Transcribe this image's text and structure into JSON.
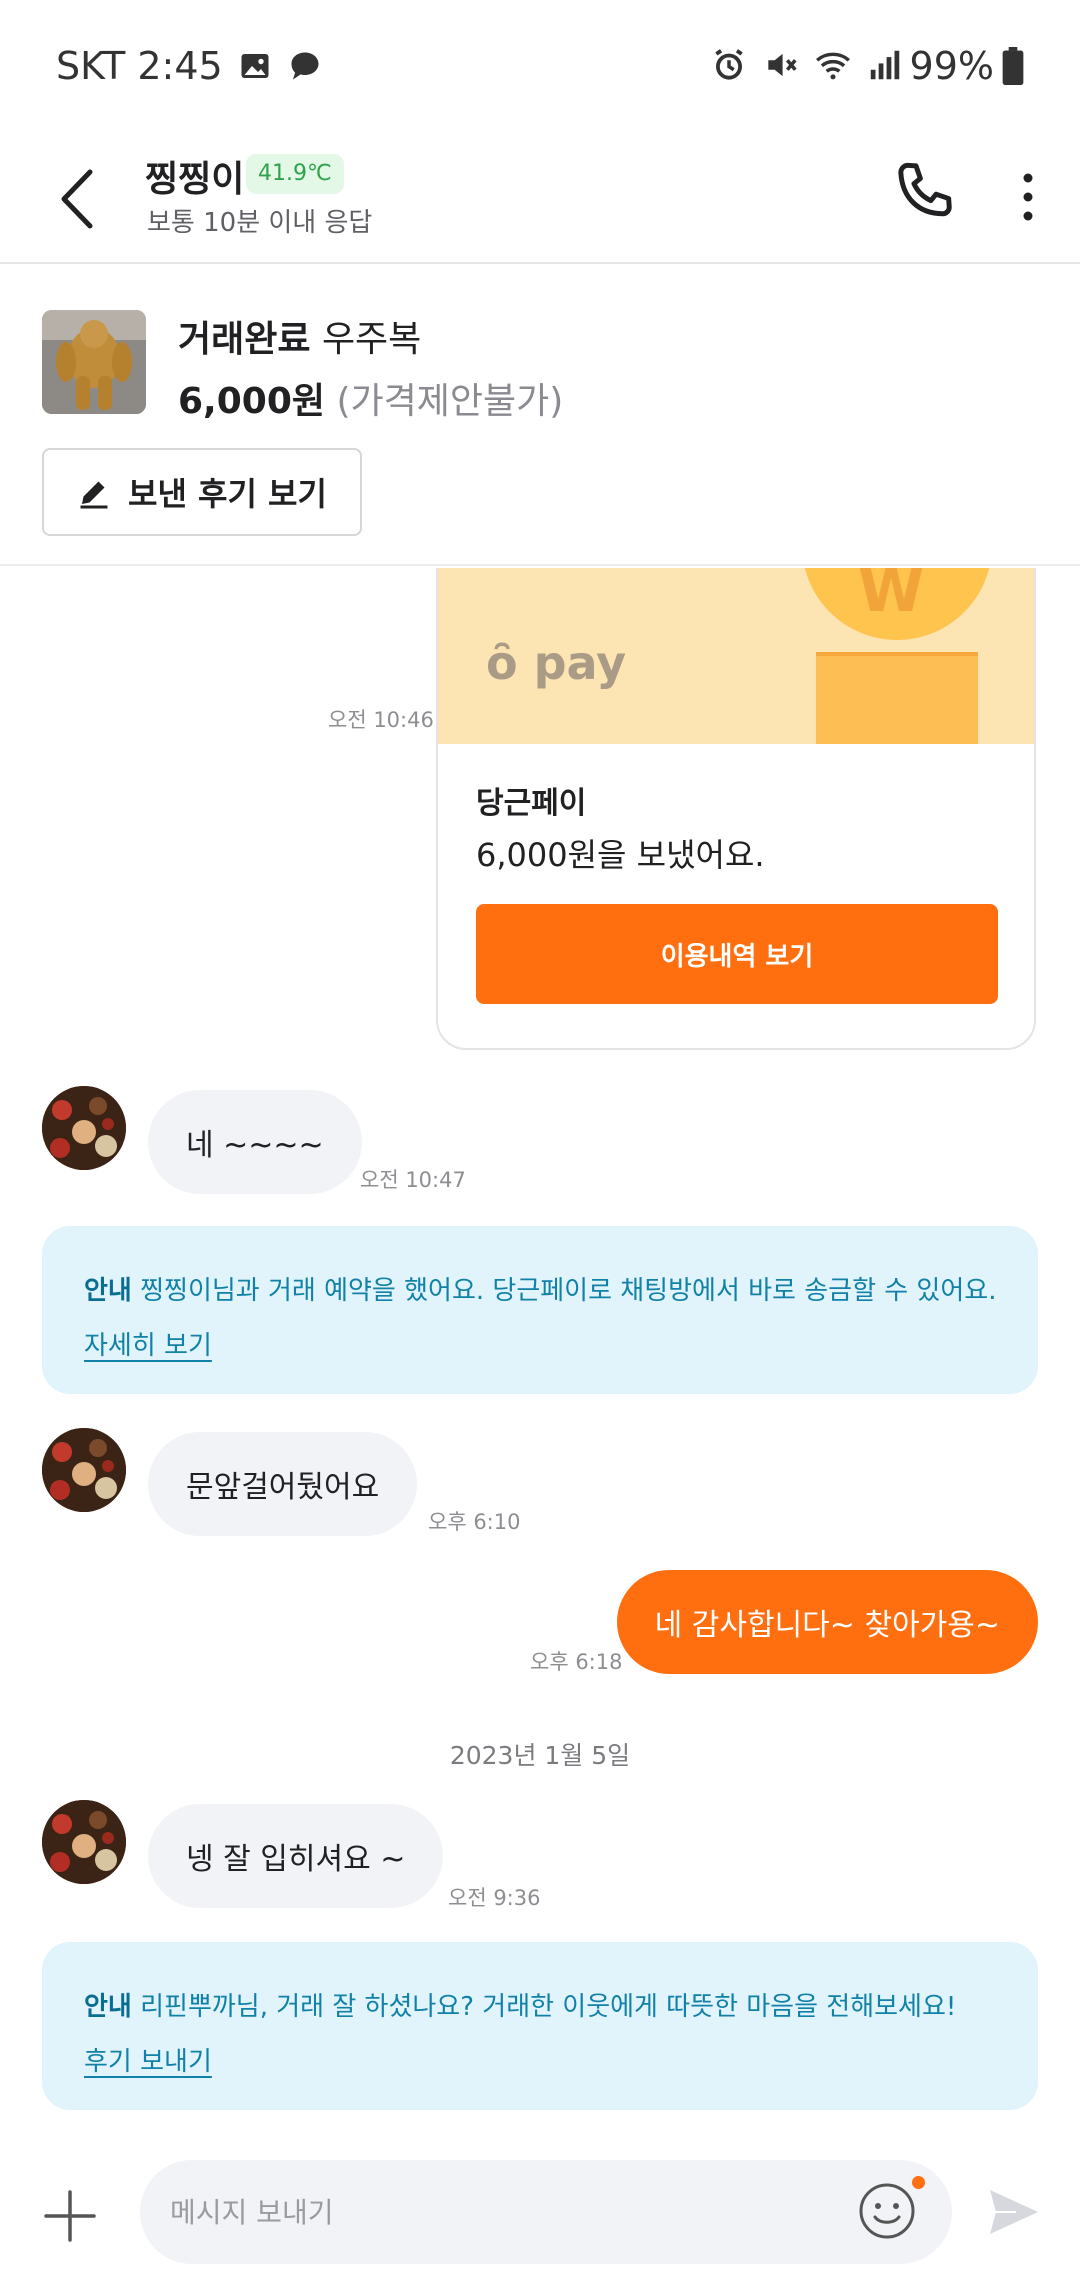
{
  "status_bar": {
    "carrier_time": "SKT 2:45",
    "battery": "99%"
  },
  "header": {
    "name": "찡찡이",
    "temperature": "41.9℃",
    "response_time": "보통 10분 이내 응답"
  },
  "product": {
    "status": "거래완료",
    "title": "우주복",
    "price": "6,000원",
    "negotiation": "(가격제안불가)",
    "review_button": "보낸 후기 보기"
  },
  "pay_card": {
    "logo": "ȏ pay",
    "coin_mark": "W",
    "title": "당근페이",
    "description": "6,000원을 보냈어요.",
    "button": "이용내역 보기",
    "time": "오전 10:46"
  },
  "messages": [
    {
      "from": "other",
      "text": "네 ~~~~",
      "time": "오전 10:47"
    },
    {
      "from": "other",
      "text": "문앞걸어뒀어요",
      "time": "오후 6:10"
    },
    {
      "from": "me",
      "text": "네 감사합니다~ 찾아가용~",
      "time": "오후 6:18"
    },
    {
      "from": "other",
      "text": "넹 잘 입히셔요 ~",
      "time": "오전 9:36"
    }
  ],
  "notices": [
    {
      "lead": "안내",
      "text": "찡찡이님과 거래 예약을 했어요. 당근페이로 채팅방에서 바로 송금할 수 있어요.",
      "link": "자세히 보기"
    },
    {
      "lead": "안내",
      "text": "리핀뿌까님, 거래 잘 하셨나요? 거래한 이웃에게 따뜻한 마음을 전해보세요!",
      "link": "후기 보내기"
    }
  ],
  "date_separator": "2023년 1월 5일",
  "input": {
    "placeholder": "메시지 보내기"
  },
  "colors": {
    "brand_orange": "#ff6f0f",
    "notice_bg": "#e1f3fb",
    "notice_text": "#1181a8",
    "bubble_in": "#f2f3f6",
    "temp_green": "#2ea349"
  },
  "icons": {
    "back": "chevron-left-icon",
    "call": "phone-icon",
    "more": "more-vertical-icon",
    "review": "pencil-icon",
    "plus": "plus-icon",
    "emoji": "smile-icon",
    "send": "send-icon"
  }
}
